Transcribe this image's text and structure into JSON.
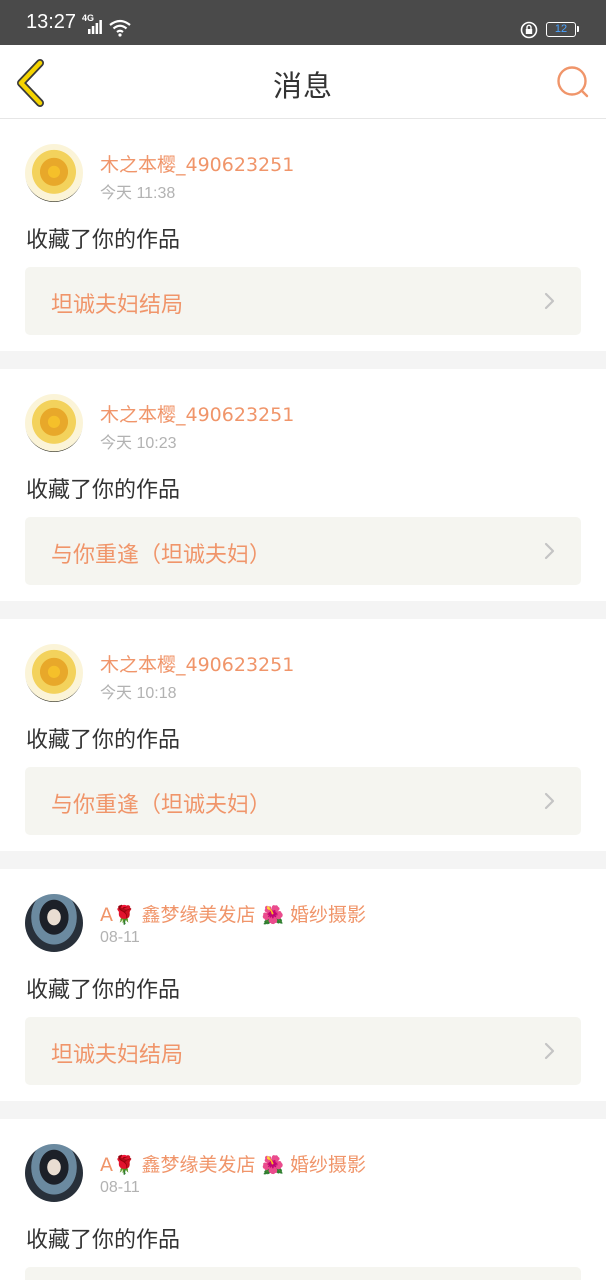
{
  "status_bar": {
    "time": "13:27",
    "network": "4G",
    "battery": "12"
  },
  "header": {
    "title": "消息"
  },
  "colors": {
    "accent": "#f0956a",
    "back_icon_fill": "#f5d400",
    "card_link_bg": "#f5f5f0"
  },
  "messages": [
    {
      "user": "木之本樱_490623251",
      "time": "今天 11:38",
      "action": "收藏了你的作品",
      "work": "坦诚夫妇结局"
    },
    {
      "user": "木之本樱_490623251",
      "time": "今天 10:23",
      "action": "收藏了你的作品",
      "work": "与你重逢（坦诚夫妇）"
    },
    {
      "user": "木之本樱_490623251",
      "time": "今天 10:18",
      "action": "收藏了你的作品",
      "work": "与你重逢（坦诚夫妇）"
    },
    {
      "user_prefix": "A",
      "user_mid": " 鑫梦缘美发店 ",
      "user_suffix": " 婚纱摄影",
      "time": "08-11",
      "action": "收藏了你的作品",
      "work": "坦诚夫妇结局"
    },
    {
      "user_prefix": "A",
      "user_mid": " 鑫梦缘美发店 ",
      "user_suffix": " 婚纱摄影",
      "time": "08-11",
      "action": "收藏了你的作品"
    }
  ],
  "emoji": {
    "rose": "🌹",
    "hibiscus": "🌺"
  }
}
